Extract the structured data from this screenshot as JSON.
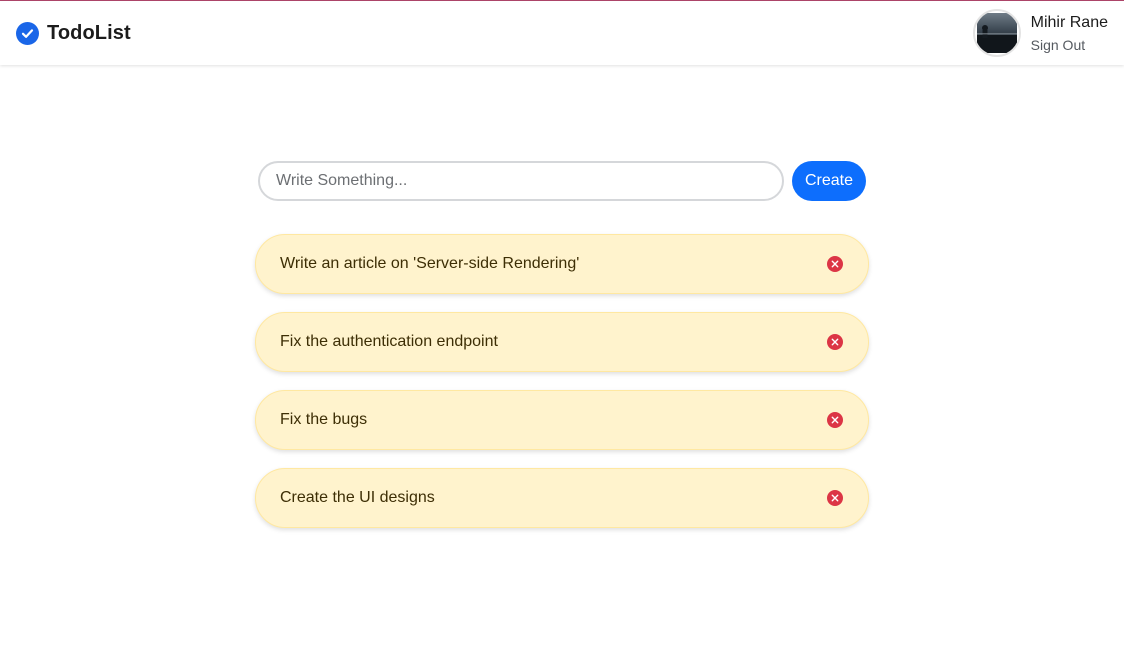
{
  "app": {
    "title": "TodoList",
    "accent_color": "#0d6efd",
    "logo_icon": "check-circle-icon"
  },
  "user": {
    "name": "Mihir Rane",
    "sign_out_label": "Sign Out",
    "avatar_icon": "avatar-photo"
  },
  "composer": {
    "placeholder": "Write Something...",
    "value": "",
    "create_label": "Create"
  },
  "todos": [
    {
      "text": "Write an article on 'Server-side Rendering'",
      "delete_icon": "x-circle-icon"
    },
    {
      "text": "Fix the authentication endpoint",
      "delete_icon": "x-circle-icon"
    },
    {
      "text": "Fix the bugs",
      "delete_icon": "x-circle-icon"
    },
    {
      "text": "Create the UI designs",
      "delete_icon": "x-circle-icon"
    }
  ],
  "colors": {
    "todo_background": "#fff3cd",
    "delete_color": "#dc3545",
    "create_button": "#0d6efd"
  }
}
